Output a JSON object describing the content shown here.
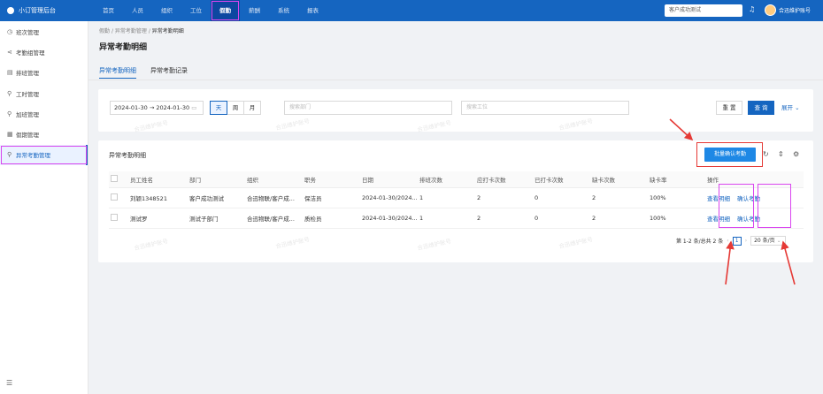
{
  "app": {
    "title": "小订管理后台"
  },
  "topnav": [
    "首页",
    "人员",
    "组织",
    "工位",
    "假勤",
    "薪酬",
    "系统",
    "报表"
  ],
  "topnav_active": 4,
  "header": {
    "search_value": "客户成功测试",
    "user": "合迅维护账号"
  },
  "sidebar": {
    "items": [
      {
        "icon": "clock-icon",
        "glyph": "◷",
        "label": "班次管理"
      },
      {
        "icon": "share-icon",
        "glyph": "⋖",
        "label": "考勤组管理"
      },
      {
        "icon": "grid-icon",
        "glyph": "▤",
        "label": "排班管理"
      },
      {
        "icon": "person-icon",
        "glyph": "⚲",
        "label": "工时管理"
      },
      {
        "icon": "person-icon",
        "glyph": "⚲",
        "label": "加班管理"
      },
      {
        "icon": "calendar-icon",
        "glyph": "▦",
        "label": "假期管理"
      },
      {
        "icon": "person-icon",
        "glyph": "⚲",
        "label": "异常考勤管理"
      }
    ],
    "active": 6
  },
  "breadcrumb": {
    "l1": "假勤",
    "sep": "/",
    "l2": "异常考勤管理",
    "l3": "异常考勤明细"
  },
  "page_title": "异常考勤明细",
  "tabs": [
    "异常考勤明细",
    "异常考勤记录"
  ],
  "filter": {
    "date_range": "2024-01-30  →  2024-01-30",
    "segments": [
      "天",
      "周",
      "月"
    ],
    "dept_placeholder": "搜索部门",
    "station_placeholder": "搜索工位",
    "reset": "重 置",
    "query": "查 询",
    "expand": "展开"
  },
  "table_panel": {
    "title": "异常考勤明细",
    "batch_button": "批量确认考勤"
  },
  "table": {
    "columns": [
      "",
      "员工姓名",
      "部门",
      "组织",
      "职务",
      "日期",
      "排班次数",
      "应打卡次数",
      "已打卡次数",
      "缺卡次数",
      "缺卡率",
      "操作"
    ],
    "rows": [
      {
        "num": "1",
        "name": "刘颖1348521",
        "dept": "客户成功测试",
        "org": "合迅物联/客户成...",
        "title": "保洁员",
        "date": "2024-01-30/2024...",
        "shifts": "1",
        "should": "2",
        "done": "0",
        "missed": "2",
        "rate": "100%",
        "view": "查看明细",
        "confirm": "确认考勤"
      },
      {
        "num": "2",
        "name": "测试罗",
        "dept": "测试子部门",
        "org": "合迅物联/客户成...",
        "title": "质检员",
        "date": "2024-01-30/2024...",
        "shifts": "1",
        "should": "2",
        "done": "0",
        "missed": "2",
        "rate": "100%",
        "view": "查看明细",
        "confirm": "确认考勤"
      }
    ]
  },
  "pager": {
    "summary": "第 1-2 条/总共 2 条",
    "page": "1",
    "size": "20 条/页"
  },
  "watermark": "合迅维护账号",
  "colors": {
    "primary": "#1565c0",
    "highlight": "#d946ef",
    "arrow": "#e53935"
  }
}
